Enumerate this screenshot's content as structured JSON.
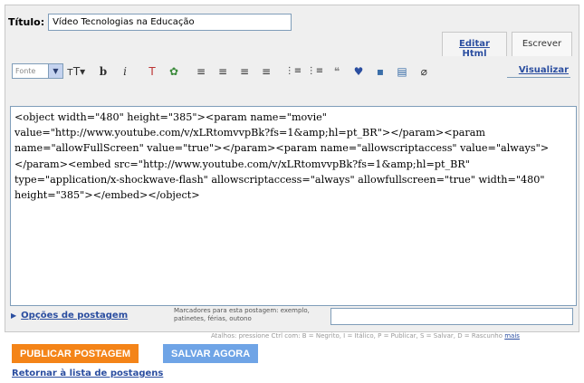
{
  "title": {
    "label": "Título:",
    "value": "Vídeo Tecnologias na Educação"
  },
  "tabs": {
    "edit_html": "Editar Html",
    "compose": "Escrever"
  },
  "toolbar": {
    "font_select_value": "Fonte",
    "buttons": [
      {
        "icon": "text-size-icon",
        "glyph": "тT▾"
      },
      {
        "icon": "bold-icon",
        "glyph": "b"
      },
      {
        "icon": "italic-icon",
        "glyph": "i"
      },
      {
        "icon": "text-color-icon",
        "glyph": "T"
      },
      {
        "icon": "link-icon",
        "glyph": "✿"
      },
      {
        "icon": "align-left-icon",
        "glyph": "≡"
      },
      {
        "icon": "align-center-icon",
        "glyph": "≡"
      },
      {
        "icon": "align-right-icon",
        "glyph": "≡"
      },
      {
        "icon": "align-justify-icon",
        "glyph": "≡"
      },
      {
        "icon": "numbered-list-icon",
        "glyph": "⋮≡"
      },
      {
        "icon": "bulleted-list-icon",
        "glyph": "⋮≡"
      },
      {
        "icon": "blockquote-icon",
        "glyph": "❝"
      },
      {
        "icon": "spellcheck-icon",
        "glyph": "♥"
      },
      {
        "icon": "image-icon",
        "glyph": "▪"
      },
      {
        "icon": "video-icon",
        "glyph": "▤"
      },
      {
        "icon": "eraser-icon",
        "glyph": "⌀"
      }
    ],
    "preview_label": "Visualizar"
  },
  "editor": {
    "content": "<object width=\"480\" height=\"385\"><param name=\"movie\" value=\"http://www.youtube.com/v/xLRtomvvpBk?fs=1&amp;hl=pt_BR\"></param><param name=\"allowFullScreen\" value=\"true\"></param><param name=\"allowscriptaccess\" value=\"always\"></param><embed src=\"http://www.youtube.com/v/xLRtomvvpBk?fs=1&amp;hl=pt_BR\" type=\"application/x-shockwave-flash\" allowscriptaccess=\"always\" allowfullscreen=\"true\" width=\"480\" height=\"385\"></embed></object>"
  },
  "post_options": {
    "label": "Opções de postagem"
  },
  "labels": {
    "hint": "Marcadores para esta postagem: exemplo, patinetes, férias, outono",
    "value": ""
  },
  "shortcuts": {
    "text": "Atalhos: pressione Ctrl com: B = Negrito, I = Itálico, P = Publicar, S = Salvar, D = Rascunho",
    "more": "mais"
  },
  "actions": {
    "publish": "PUBLICAR POSTAGEM",
    "save": "SALVAR AGORA"
  },
  "return_link": "Retornar à lista de postagens",
  "colors": {
    "publish_bg": "#f48418",
    "save_bg": "#6fa4e6",
    "link": "#2b4ea0"
  }
}
